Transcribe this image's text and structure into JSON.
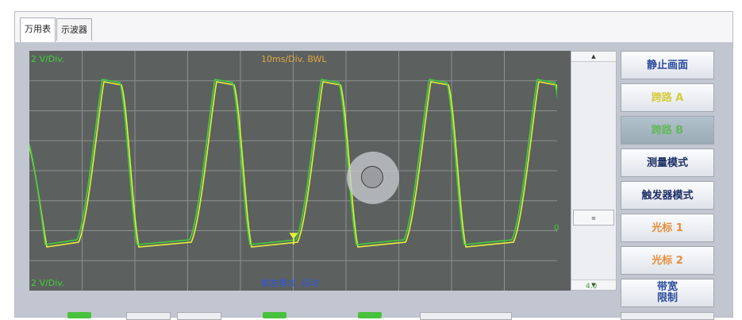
{
  "tabs": [
    {
      "label": "万用表",
      "active": true
    },
    {
      "label": "示波器",
      "active": false
    }
  ],
  "scope": {
    "ch1_scale": "2 V/Div.",
    "ch2_scale": "2 V/Div.",
    "timebase": "10ms/Div. BWL",
    "status": "触发模式 .自动",
    "marker_label": "0",
    "trace_colors": {
      "ch1": "#e8ef3a",
      "ch2": "#3fd03a"
    },
    "grid": {
      "columns": 10,
      "rows": 8,
      "color": "#8c918f"
    }
  },
  "scrollbar": {
    "up_icon": "▲",
    "down_icon": "▼",
    "thumb_label": "≡",
    "value": "4.0"
  },
  "buttons": [
    {
      "label": "静止画面"
    },
    {
      "label": "跨路 A"
    },
    {
      "label": "跨路 B"
    },
    {
      "label": "测量模式"
    },
    {
      "label": "触发器模式"
    },
    {
      "label": "光标 1"
    },
    {
      "label": "光标 2"
    },
    {
      "label": "带宽\n限制"
    }
  ],
  "colors": {
    "accent_blue": "#2c4c9e",
    "accent_orange": "#e68e3c",
    "accent_yellow": "#d6cb3a",
    "accent_green": "#63b85b"
  }
}
